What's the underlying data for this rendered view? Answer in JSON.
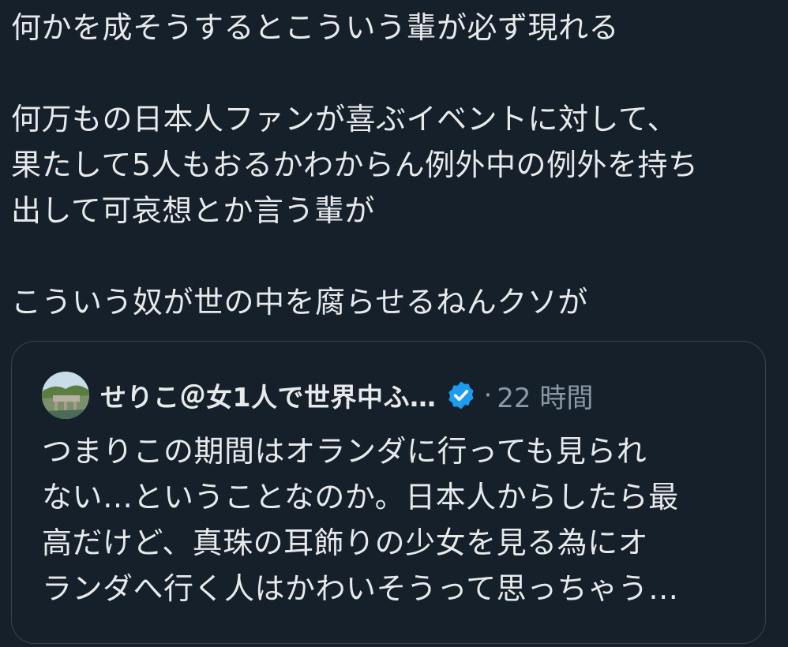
{
  "tweet": {
    "lines": [
      "何かを成そうするとこういう輩が必ず現れる",
      "",
      "何万もの日本人ファンが喜ぶイベントに対して、",
      "果たして5人もおるかわからん例外中の例外を持ち",
      "出して可哀想とか言う輩が",
      "",
      "こういう奴が世の中を腐らせるねんクソが"
    ]
  },
  "quote": {
    "author_name": "せりこ＠女1人で世界中ふ…",
    "separator": "·",
    "timestamp": "22 時間",
    "verified_icon": "verified-badge-icon",
    "lines": [
      "つまりこの期間はオランダに行っても見られ",
      "ない…ということなのか。日本人からしたら最",
      "高だけど、真珠の耳飾りの少女を見る為にオ",
      "ランダへ行く人はかわいそうって思っちゃう…"
    ]
  },
  "colors": {
    "background": "#15202b",
    "text": "#e7e9ea",
    "muted": "#8b98a5",
    "border": "#38444d",
    "verified": "#1d9bf0"
  }
}
